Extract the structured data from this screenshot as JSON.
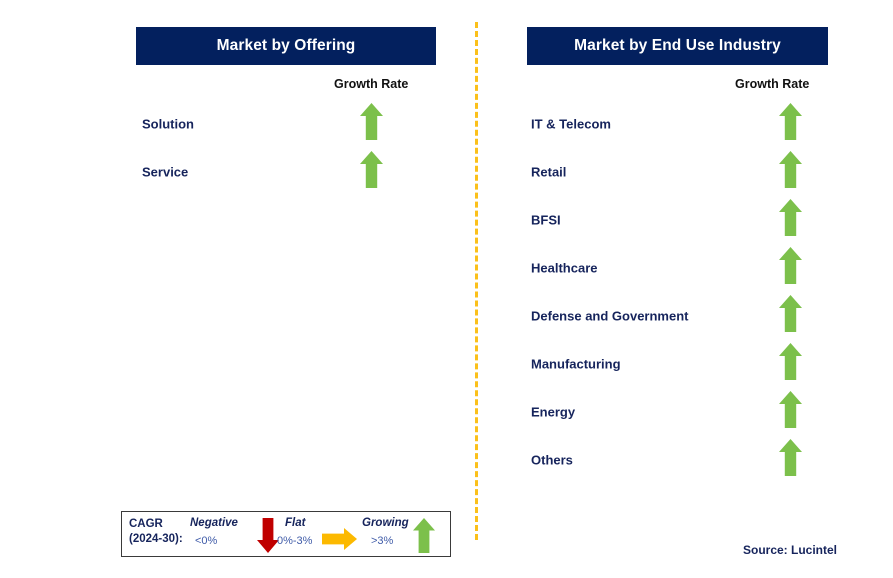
{
  "colors": {
    "header_bg": "#03205e",
    "header_text": "#ffffff",
    "label_text": "#16245c",
    "arrow_up": "#7cc04b",
    "arrow_down": "#c00000",
    "arrow_flat": "#fcb900",
    "divider": "#fbc01a",
    "legend_range_text": "#3f5ba8",
    "legend_border": "#3a3a3a"
  },
  "panels": [
    {
      "id": "offering",
      "title": "Market by Offering",
      "growth_caption": "Growth Rate",
      "rows": [
        {
          "label": "Solution",
          "trend": "growing",
          "icon": "arrow-up-icon"
        },
        {
          "label": "Service",
          "trend": "growing",
          "icon": "arrow-up-icon"
        }
      ]
    },
    {
      "id": "enduse",
      "title": "Market by End Use Industry",
      "growth_caption": "Growth Rate",
      "rows": [
        {
          "label": "IT & Telecom",
          "trend": "growing",
          "icon": "arrow-up-icon"
        },
        {
          "label": "Retail",
          "trend": "growing",
          "icon": "arrow-up-icon"
        },
        {
          "label": "BFSI",
          "trend": "growing",
          "icon": "arrow-up-icon"
        },
        {
          "label": "Healthcare",
          "trend": "growing",
          "icon": "arrow-up-icon"
        },
        {
          "label": "Defense and Government",
          "trend": "growing",
          "icon": "arrow-up-icon"
        },
        {
          "label": "Manufacturing",
          "trend": "growing",
          "icon": "arrow-up-icon"
        },
        {
          "label": "Energy",
          "trend": "growing",
          "icon": "arrow-up-icon"
        },
        {
          "label": "Others",
          "trend": "growing",
          "icon": "arrow-up-icon"
        }
      ]
    }
  ],
  "legend": {
    "title_line1": "CAGR",
    "title_line2": "(2024-30):",
    "items": [
      {
        "term": "Negative",
        "range": "<0%",
        "icon": "arrow-down-icon"
      },
      {
        "term": "Flat",
        "range": "0%-3%",
        "icon": "arrow-right-icon"
      },
      {
        "term": "Growing",
        "range": ">3%",
        "icon": "arrow-up-icon"
      }
    ]
  },
  "source": "Source: Lucintel"
}
